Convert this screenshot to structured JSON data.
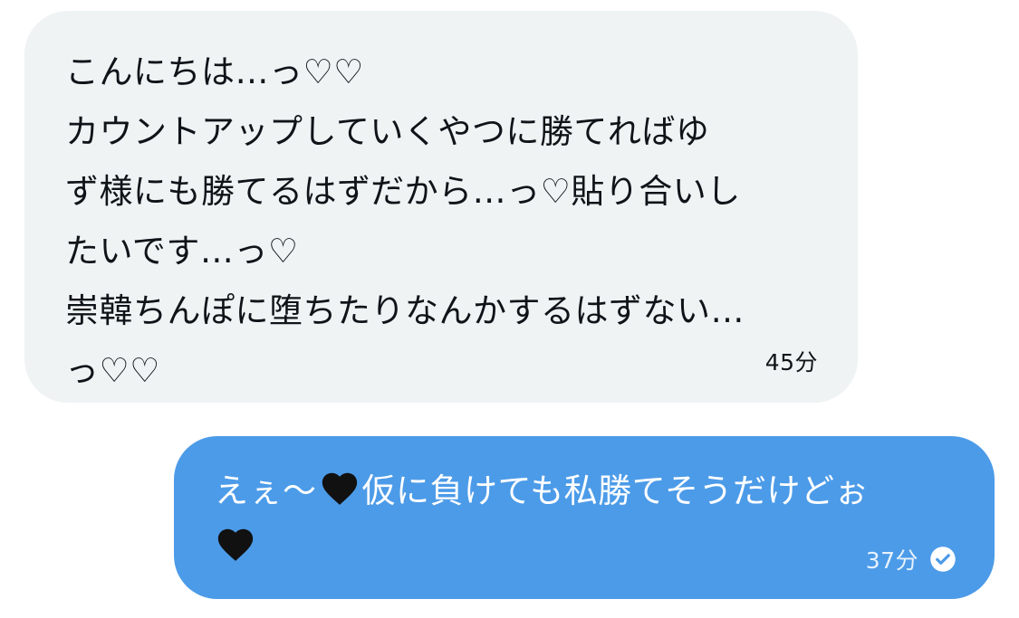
{
  "conversation": {
    "received": {
      "lines": [
        "こんにちは…っ♡♡",
        "カウントアップしていくやつに勝てればゆ",
        "ず様にも勝てるはずだから…っ♡貼り合いし",
        "たいです…っ♡",
        "崇韓ちんぽに堕ちたりなんかするはずない…",
        "っ♡♡"
      ],
      "time": "45分"
    },
    "sent": {
      "line1_before": "えぇ〜",
      "line1_after": "仮に負けても私勝てそうだけどぉ",
      "time": "37分",
      "icons": [
        "black-heart-icon",
        "read-check-icon"
      ],
      "colors": {
        "bubble": "#4c9be8",
        "heart": "#111111"
      }
    }
  }
}
